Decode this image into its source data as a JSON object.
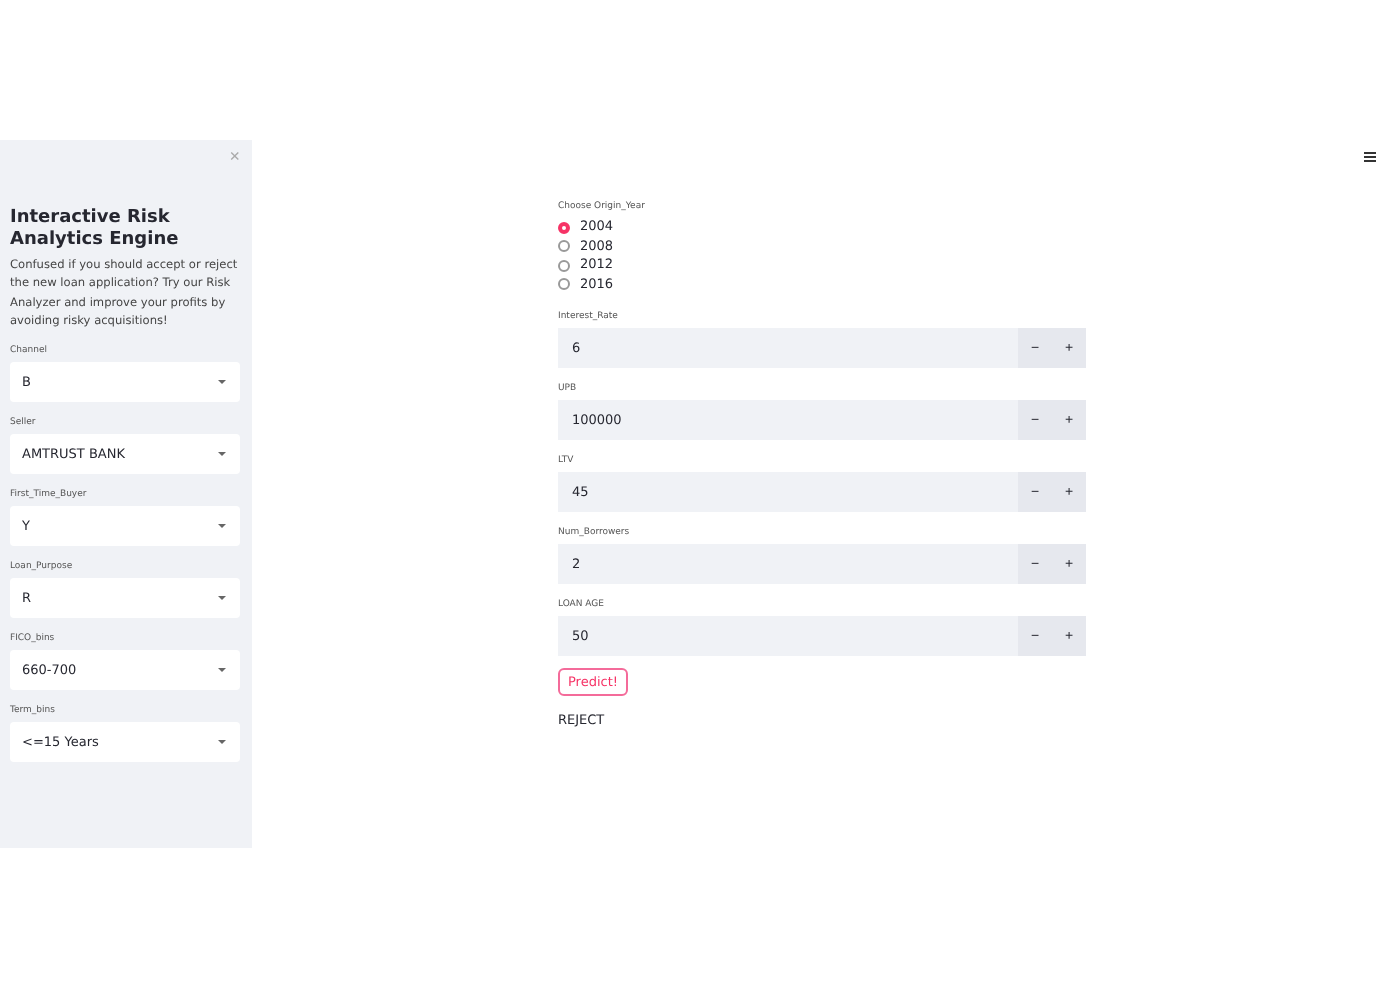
{
  "sidebar": {
    "close": "×",
    "title": "Interactive Risk Analytics Engine",
    "description": "Confused if you should accept or reject the new loan application? Try our Risk Analyzer and improve your profits by avoiding risky acquisitions!",
    "selects": [
      {
        "label": "Channel",
        "value": "B"
      },
      {
        "label": "Seller",
        "value": "AMTRUST BANK"
      },
      {
        "label": "First_Time_Buyer",
        "value": "Y"
      },
      {
        "label": "Loan_Purpose",
        "value": "R"
      },
      {
        "label": "FICO_bins",
        "value": "660-700"
      },
      {
        "label": "Term_bins",
        "value": "<=15 Years"
      }
    ]
  },
  "main": {
    "radio_group": {
      "label": "Choose Origin_Year",
      "options": [
        {
          "label": "2004",
          "selected": true
        },
        {
          "label": "2008",
          "selected": false
        },
        {
          "label": "2012",
          "selected": false
        },
        {
          "label": "2016",
          "selected": false
        }
      ]
    },
    "number_inputs": [
      {
        "label": "Interest_Rate",
        "value": "6",
        "decrement": "−",
        "increment": "+"
      },
      {
        "label": "UPB",
        "value": "100000",
        "decrement": "−",
        "increment": "+"
      },
      {
        "label": "LTV",
        "value": "45",
        "decrement": "−",
        "increment": "+"
      },
      {
        "label": "Num_Borrowers",
        "value": "2",
        "decrement": "−",
        "increment": "+"
      },
      {
        "label": "LOAN AGE",
        "value": "50",
        "decrement": "−",
        "increment": "+"
      }
    ],
    "button": "Predict!",
    "result": "REJECT"
  }
}
